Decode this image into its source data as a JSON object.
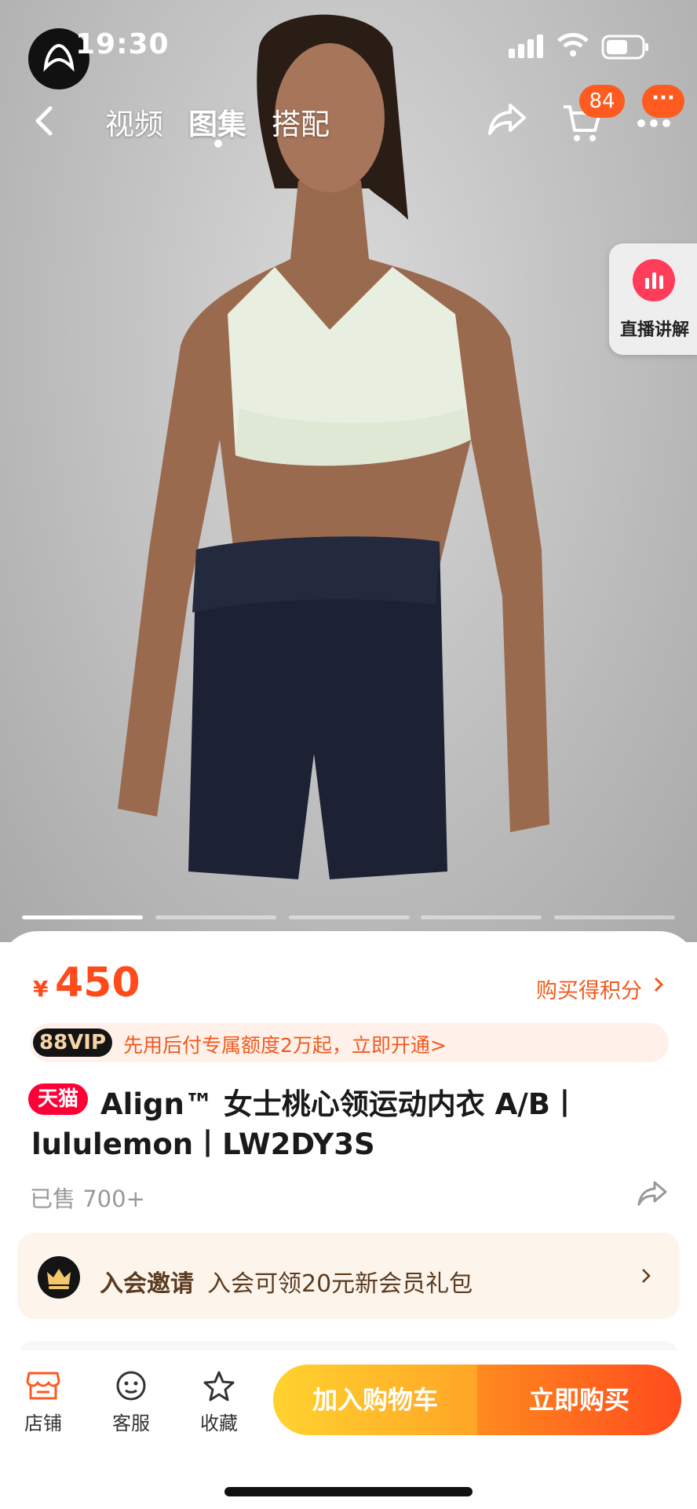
{
  "status_bar": {
    "time": "19:30"
  },
  "nav": {
    "tabs": [
      {
        "label": "视频",
        "active": false
      },
      {
        "label": "图集",
        "active": true
      },
      {
        "label": "搭配",
        "active": false
      }
    ],
    "cart_count": "84",
    "more_label": "···"
  },
  "live": {
    "label": "直播讲解"
  },
  "gallery": {
    "total_images": 5,
    "current_index": 1
  },
  "product": {
    "currency": "¥",
    "price": "450",
    "points_link": "购买得积分",
    "vip_badge": "88VIP",
    "vip_text": "先用后付专属额度2万起，立即开通>",
    "platform_badge": "天猫",
    "title_line1": "Align™ 女士桃心领运动内衣 A/B丨",
    "title_line2": "lululemon丨LW2DY3S",
    "sold": "已售 700+"
  },
  "member": {
    "title": "入会邀请",
    "text": "入会可领20元新会员礼包"
  },
  "bottom_bar": {
    "items": [
      {
        "label": "店铺",
        "icon": "store-icon"
      },
      {
        "label": "客服",
        "icon": "customer-service-icon"
      },
      {
        "label": "收藏",
        "icon": "star-icon"
      }
    ],
    "add_to_cart": "加入购物车",
    "buy_now": "立即购买"
  },
  "colors": {
    "accent": "#ff4a1a",
    "tmall_red": "#ff0036",
    "cart_button": "#ffb526",
    "buy_button": "#ff6a1e"
  }
}
